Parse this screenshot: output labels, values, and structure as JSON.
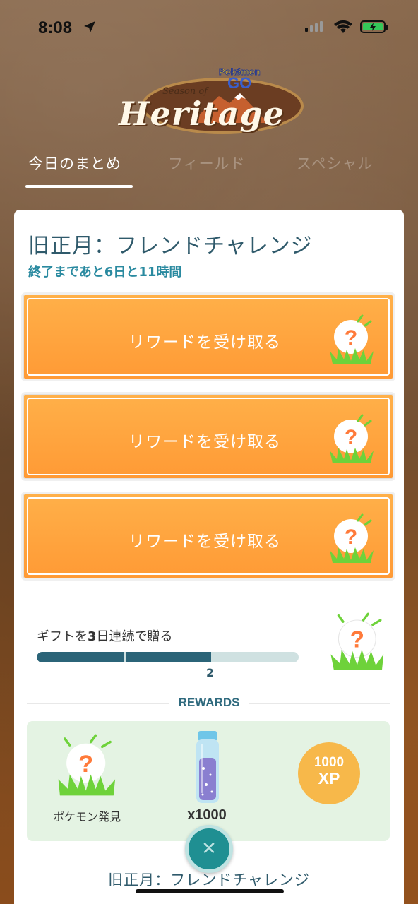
{
  "status_bar": {
    "time": "8:08",
    "signal_bars": 4,
    "signal_active": 1,
    "battery": "charging"
  },
  "logo": {
    "season": "Season of",
    "title": "Heritage",
    "brand_top": "Pokémon",
    "brand_bottom": "GO"
  },
  "tabs": [
    {
      "label": "今日のまとめ",
      "active": true
    },
    {
      "label": "フィールド",
      "active": false
    },
    {
      "label": "スペシャル",
      "active": false
    }
  ],
  "card": {
    "title": "旧正月：フレンドチャレンジ",
    "time_remaining": "終了まであと6日と11時間",
    "reward_buttons": [
      {
        "label": "リワードを受け取る",
        "icon": "mystery-pokemon-icon"
      },
      {
        "label": "リワードを受け取る",
        "icon": "mystery-pokemon-icon"
      },
      {
        "label": "リワードを受け取る",
        "icon": "mystery-pokemon-icon"
      }
    ],
    "friend_task": {
      "label_prefix": "ギフトを",
      "label_number": "3",
      "label_suffix": "日連続で贈る",
      "progress_value": "2",
      "progress_current": 2,
      "progress_total": 3
    },
    "rewards_title": "REWARDS",
    "rewards": {
      "pokemon_label": "ポケモン発見",
      "item_label": "x1000",
      "xp_number": "1000",
      "xp_unit": "XP"
    }
  },
  "close_icon": "close-icon",
  "bottom_title": "旧正月：フレンドチャレンジ",
  "colors": {
    "accent": "#ff9a35",
    "teal": "#2b6478",
    "rewards_bg": "#e4f3e3",
    "xp": "#f7b84a"
  }
}
